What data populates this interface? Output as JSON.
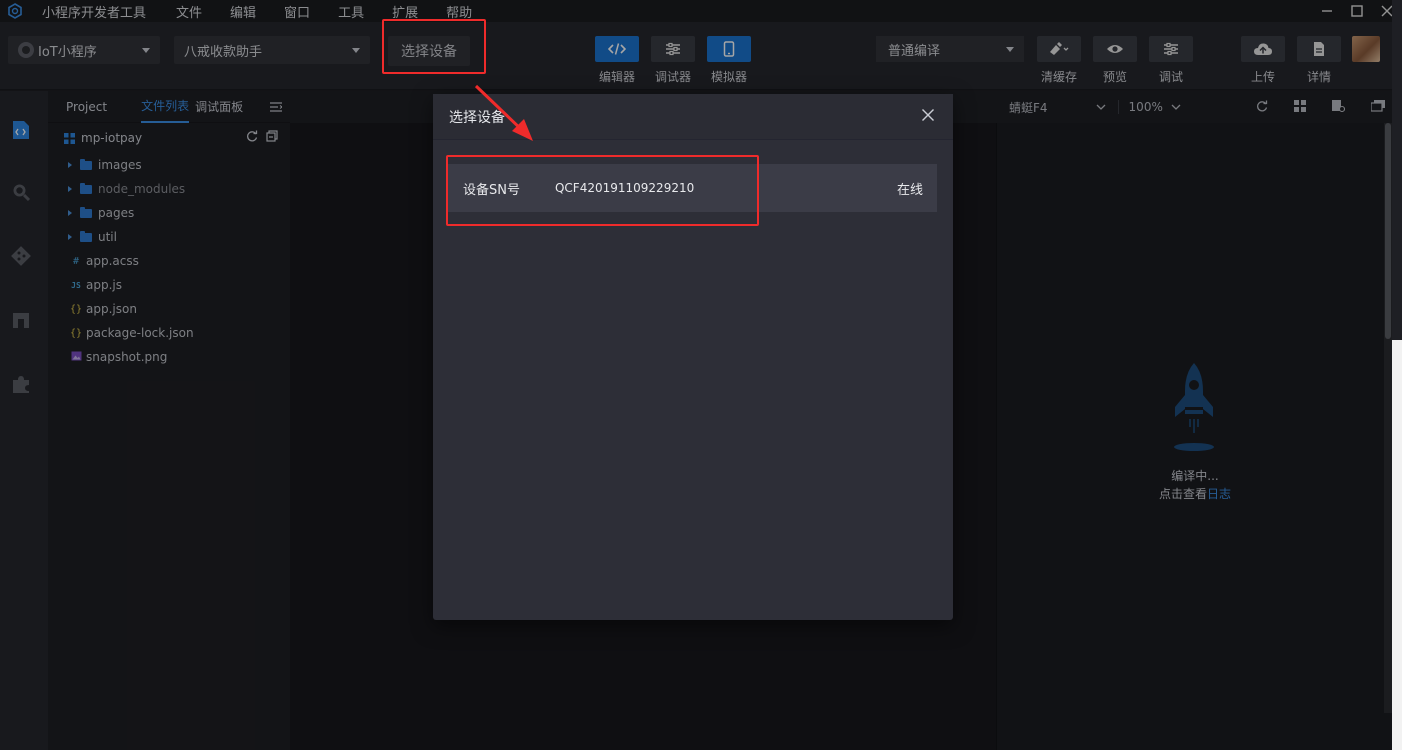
{
  "menubar": {
    "app_title": "小程序开发者工具",
    "items": [
      "文件",
      "编辑",
      "窗口",
      "工具",
      "扩展",
      "帮助"
    ]
  },
  "toolbar": {
    "app_type": "IoT小程序",
    "project": "八戒收款助手",
    "device_button": "选择设备",
    "views": [
      {
        "label": "编辑器",
        "icon": "code-icon",
        "active": true
      },
      {
        "label": "调试器",
        "icon": "sliders-icon",
        "active": false
      },
      {
        "label": "模拟器",
        "icon": "phone-icon",
        "active": true
      }
    ],
    "compile_mode": "普通编译",
    "actions": [
      {
        "label": "清缓存",
        "icon": "broom-icon"
      },
      {
        "label": "预览",
        "icon": "eye-icon"
      },
      {
        "label": "调试",
        "icon": "sliders-icon"
      },
      {
        "label": "上传",
        "icon": "cloud-upload-icon"
      },
      {
        "label": "详情",
        "icon": "document-icon"
      }
    ]
  },
  "file_panel": {
    "tabs": [
      "Project",
      "文件列表",
      "调试面板"
    ],
    "active_tab": "文件列表",
    "project_name": "mp-iotpay",
    "tree": [
      {
        "name": "images",
        "type": "folder"
      },
      {
        "name": "node_modules",
        "type": "folder"
      },
      {
        "name": "pages",
        "type": "folder"
      },
      {
        "name": "util",
        "type": "folder"
      },
      {
        "name": "app.acss",
        "type": "css",
        "badge": "#"
      },
      {
        "name": "app.js",
        "type": "js",
        "badge": "JS"
      },
      {
        "name": "app.json",
        "type": "json",
        "badge": "{}"
      },
      {
        "name": "package-lock.json",
        "type": "json",
        "badge": "{}"
      },
      {
        "name": "snapshot.png",
        "type": "image",
        "badge": ""
      }
    ]
  },
  "simulator": {
    "device": "蜻蜓F4",
    "zoom": "100%",
    "status_line1": "编译中...",
    "status_line2_prefix": "点击查看",
    "status_line2_link": "日志"
  },
  "modal": {
    "title": "选择设备",
    "row_label": "设备SN号",
    "row_value": "QCF420191109229210",
    "row_status": "在线"
  },
  "colors": {
    "accent": "#1b73d0",
    "link": "#3b8fe6",
    "highlight": "#ef2b2b"
  }
}
